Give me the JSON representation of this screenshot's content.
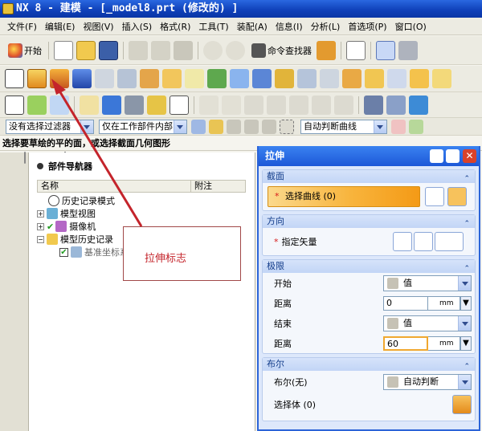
{
  "window": {
    "title": "NX 8 - 建模 - [_model8.prt  (修改的) ]"
  },
  "menu": [
    "文件(F)",
    "编辑(E)",
    "视图(V)",
    "插入(S)",
    "格式(R)",
    "工具(T)",
    "装配(A)",
    "信息(I)",
    "分析(L)",
    "首选项(P)",
    "窗口(O)"
  ],
  "toolbar1": {
    "start_label": "开始",
    "command_finder_label": "命令查找器"
  },
  "toolbar4": {
    "filter_value": "没有选择过滤器",
    "scope_value": "仅在工作部件内部",
    "curve_rule_value": "自动判断曲线"
  },
  "hint": "选择要草绘的平的面，或选择截面几何图形",
  "navigator": {
    "title": "部件导航器",
    "columns": [
      "名称",
      "附注"
    ],
    "rows": [
      {
        "label": "历史记录模式"
      },
      {
        "label": "模型视图"
      },
      {
        "label": "摄像机"
      },
      {
        "label": "模型历史记录"
      },
      {
        "label": "基准坐标系"
      }
    ]
  },
  "callout": {
    "text": "拉伸标志"
  },
  "dialog": {
    "title": "拉伸",
    "sections": {
      "section": {
        "title": "截面",
        "select_curve": "选择曲线 (0)"
      },
      "direction": {
        "title": "方向",
        "specify_vector": "指定矢量"
      },
      "limits": {
        "title": "极限",
        "start_label": "开始",
        "start_value": "值",
        "distance1_label": "距离",
        "distance1_value": "0",
        "end_label": "结束",
        "end_value": "值",
        "distance2_label": "距离",
        "distance2_value": "60",
        "unit": "mm"
      },
      "boolean": {
        "title": "布尔",
        "boolean_label": "布尔(无)",
        "boolean_value": "自动判断",
        "select_body": "选择体 (0)"
      }
    }
  },
  "colors": {
    "accent": "#2c64d8",
    "callout": "#c4242b",
    "select_highlight": "#f8b43c"
  }
}
